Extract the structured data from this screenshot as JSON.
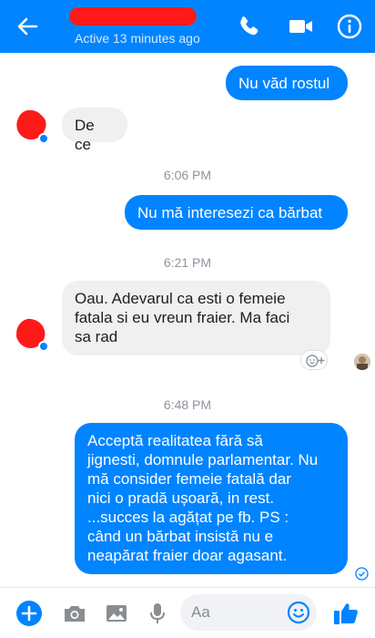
{
  "header": {
    "status": "Active 13 minutes ago",
    "icons": [
      "back-arrow-icon",
      "phone-icon",
      "video-camera-icon",
      "info-icon"
    ]
  },
  "messages": [
    {
      "type": "outgoing",
      "text": "Nu văd rostul"
    },
    {
      "type": "incoming",
      "text": "De ce"
    },
    {
      "type": "timestamp",
      "text": "6:06 PM"
    },
    {
      "type": "outgoing",
      "text": "Nu mă interesezi ca bărbat"
    },
    {
      "type": "timestamp",
      "text": "6:21 PM"
    },
    {
      "type": "incoming",
      "lines": [
        "Oau. Adevarul ca esti o femeie",
        "fatala si eu vreun fraier. Ma faci",
        "sa rad"
      ]
    },
    {
      "type": "timestamp",
      "text": "6:48 PM"
    },
    {
      "type": "outgoing",
      "lines": [
        "Acceptă realitatea fără să",
        "jignesti, domnule parlamentar. Nu",
        "mă consider femeie fatală dar",
        "nici o pradă ușoară, in rest.",
        "...succes la agățat pe fb. PS :",
        "când un bărbat insistă nu e",
        "neapărat fraier doar agasant."
      ]
    }
  ],
  "composer": {
    "placeholder": "Aa",
    "icons": [
      "plus-icon",
      "camera-icon",
      "image-icon",
      "microphone-icon",
      "emoji-icon",
      "thumbs-up-icon"
    ]
  },
  "colors": {
    "accent": "#0084ff",
    "incoming_bubble": "#f0f0f0",
    "redaction": "#ff1a1a"
  }
}
